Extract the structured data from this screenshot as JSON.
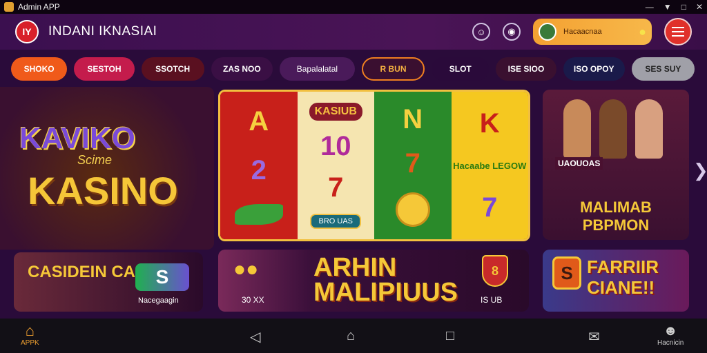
{
  "statusbar": {
    "app_title": "Admin APP"
  },
  "header": {
    "brand": "INDANI IKNASIAI",
    "logo_text": "IY",
    "account_label": "Hacaacnaa"
  },
  "tabs": [
    {
      "label": "SHOKO"
    },
    {
      "label": "SESTOH"
    },
    {
      "label": "SSOTCH"
    },
    {
      "label": "ZAS NOO"
    },
    {
      "label": "Bapalalatal"
    },
    {
      "label": "R BUN"
    },
    {
      "label": "SLOT"
    },
    {
      "label": "ISE SIOO"
    },
    {
      "label": "ISO OPOY"
    },
    {
      "label": "SES SUY"
    }
  ],
  "hero": {
    "title_top": "KAVIKO",
    "script": "Scime",
    "title_bottom": "KASINO"
  },
  "reels": {
    "col1": [
      "A",
      "2",
      ""
    ],
    "col2_badge": "KASIUB",
    "col2": [
      "10",
      "7"
    ],
    "col2_button": "BRO UAS",
    "col3": [
      "N",
      "7"
    ],
    "col4": [
      "K",
      "7"
    ],
    "col4_label": "Hacaabe LEGOW"
  },
  "promo_top": {
    "tag": "UAOUOAS",
    "title": "MALIMAB PBPMON"
  },
  "card1": {
    "title": "CASIDEIN CASIDAY",
    "badge": "S",
    "caption": "Nacegaagin"
  },
  "card2": {
    "caption": "30 XX",
    "title": "ARHIN MALIPIUUS",
    "shield": "8",
    "caption2": "IS UB"
  },
  "card3": {
    "badge": "S",
    "title": "FARRIIR CIANE!!"
  },
  "nav": {
    "home_label": "APPK",
    "profile_label": "Hacnicin"
  }
}
